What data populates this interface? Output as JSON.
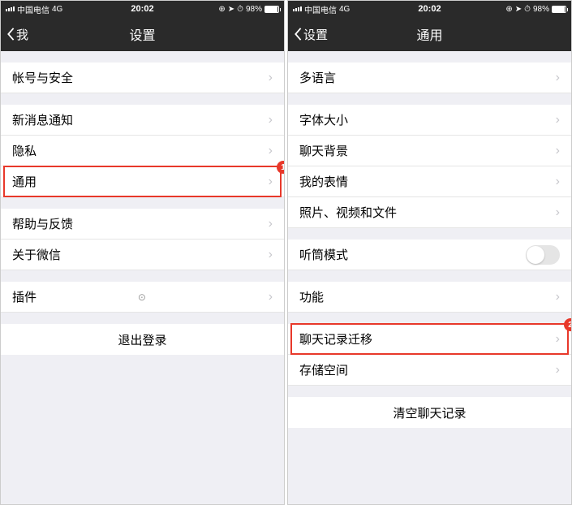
{
  "status": {
    "carrier": "中国电信",
    "network": "4G",
    "time": "20:02",
    "battery_pct": "98%"
  },
  "left": {
    "back_label": "我",
    "title": "设置",
    "rows": {
      "account": "帐号与安全",
      "notif": "新消息通知",
      "privacy": "隐私",
      "general": "通用",
      "help": "帮助与反馈",
      "about": "关于微信",
      "plugins": "插件",
      "logout": "退出登录"
    },
    "badge": "1"
  },
  "right": {
    "back_label": "设置",
    "title": "通用",
    "rows": {
      "language": "多语言",
      "font": "字体大小",
      "chatbg": "聊天背景",
      "emoji": "我的表情",
      "media": "照片、视频和文件",
      "earpiece": "听筒模式",
      "features": "功能",
      "migrate": "聊天记录迁移",
      "storage": "存储空间",
      "clear": "清空聊天记录"
    },
    "badge": "2"
  }
}
